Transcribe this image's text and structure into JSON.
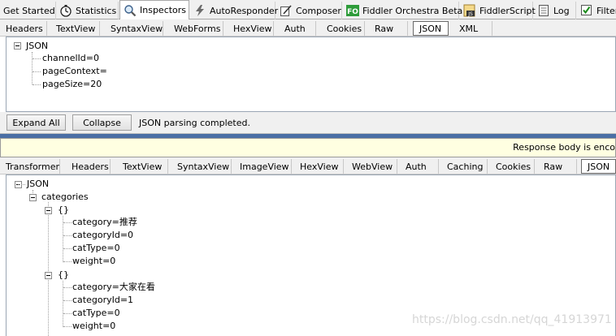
{
  "top_tabs": [
    {
      "label": "Get Started"
    },
    {
      "label": "Statistics",
      "icon": "stopwatch-icon"
    },
    {
      "label": "Inspectors",
      "icon": "magnifier-icon",
      "active": true
    },
    {
      "label": "AutoResponder",
      "icon": "lightning-icon"
    },
    {
      "label": "Composer",
      "icon": "compose-icon"
    },
    {
      "label": "Fiddler Orchestra Beta",
      "icon": "fo-icon",
      "icon_text": "FO"
    },
    {
      "label": "FiddlerScript",
      "icon": "script-icon",
      "icon_text": "JS"
    },
    {
      "label": "Log",
      "icon": "log-icon"
    },
    {
      "label": "Filters",
      "icon": "checkbox-icon"
    }
  ],
  "request": {
    "tabs": [
      "Headers",
      "TextView",
      "SyntaxView",
      "WebForms",
      "HexView",
      "Auth",
      "Cookies",
      "Raw",
      "JSON",
      "XML"
    ],
    "active_tab": "JSON",
    "tree": {
      "root": "JSON",
      "items": [
        "channelId=0",
        "pageContext=",
        "pageSize=20"
      ]
    },
    "buttons": {
      "expand_all": "Expand All",
      "collapse": "Collapse"
    },
    "status": "JSON parsing completed."
  },
  "response": {
    "warning": "Response body is enco",
    "tabs": [
      "Transformer",
      "Headers",
      "TextView",
      "SyntaxView",
      "ImageView",
      "HexView",
      "WebView",
      "Auth",
      "Caching",
      "Cookies",
      "Raw",
      "JSON"
    ],
    "active_tab": "JSON",
    "tree": {
      "root": "JSON",
      "categories_label": "categories",
      "object_label": "{}",
      "objects": [
        {
          "fields": [
            "category=推荐",
            "categoryId=0",
            "catType=0",
            "weight=0"
          ]
        },
        {
          "fields": [
            "category=大家在看",
            "categoryId=1",
            "catType=0",
            "weight=0"
          ]
        }
      ]
    }
  },
  "watermark": "https://blog.csdn.net/qq_41913971"
}
